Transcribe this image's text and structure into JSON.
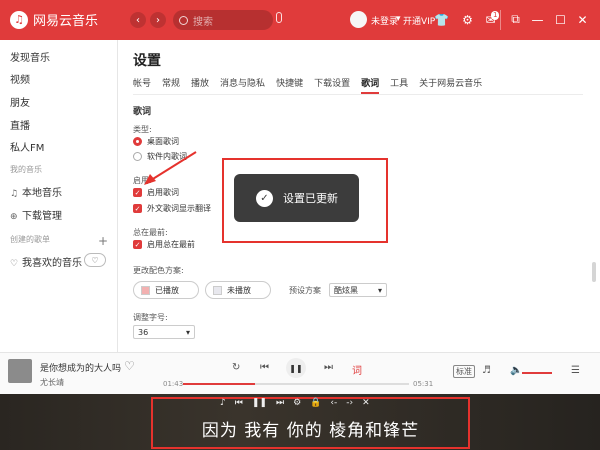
{
  "header": {
    "app_name": "网易云音乐",
    "search_placeholder": "搜索",
    "login": "未登录",
    "vip": "开通VIP",
    "mail_count": "1"
  },
  "sidebar": {
    "items": [
      "发现音乐",
      "视频",
      "朋友",
      "直播",
      "私人FM"
    ],
    "my_music_label": "我的音乐",
    "my_items": [
      "本地音乐",
      "下载管理"
    ],
    "created_label": "创建的歌单",
    "playlist": "我喜欢的音乐"
  },
  "settings": {
    "title": "设置",
    "tabs": [
      "帐号",
      "常规",
      "播放",
      "消息与隐私",
      "快捷键",
      "下载设置",
      "歌词",
      "工具",
      "关于网易云音乐"
    ],
    "active_tab": "歌词",
    "section": "歌词",
    "type_label": "类型:",
    "type_options": [
      "桌面歌词",
      "软件内歌词"
    ],
    "enable_label": "启用:",
    "enable_options": [
      "启用歌词",
      "外文歌词显示翻译"
    ],
    "top_label": "总在最前:",
    "top_option": "启用总在最前",
    "color_label": "更改配色方案:",
    "color_played": "已播放",
    "color_unplayed": "未播放",
    "preset_label": "预设方案",
    "preset_value": "酷炫黑",
    "font_label": "调整字号:",
    "font_size": "36"
  },
  "toast": {
    "message": "设置已更新"
  },
  "player": {
    "song": "是你想成为的大人吗",
    "artist": "尤长靖",
    "current_time": "01:43",
    "total_time": "05:31",
    "progress": 0.32,
    "quality": "标准",
    "lyric_btn": "词"
  },
  "lyrics": {
    "line": "因为 我有 你的 棱角和锋芒"
  },
  "colors": {
    "brand": "#e03b3b",
    "highlight": "#e5322d"
  }
}
